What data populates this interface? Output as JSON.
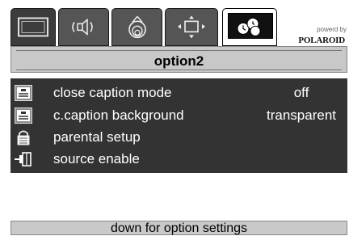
{
  "logo": {
    "powered_by": "powerd by",
    "brand": "POLAROID"
  },
  "header": {
    "title": "option2"
  },
  "menu": {
    "items": [
      {
        "label": "close caption mode",
        "value": "off",
        "icon": "closed-caption-icon"
      },
      {
        "label": "c.caption background",
        "value": "transparent",
        "icon": "closed-caption-icon"
      },
      {
        "label": "parental setup",
        "value": "",
        "icon": "lock-icon"
      },
      {
        "label": "source enable",
        "value": "",
        "icon": "input-source-icon"
      }
    ]
  },
  "footer": {
    "hint": "down for option settings"
  },
  "tabs": [
    {
      "icon": "picture-icon"
    },
    {
      "icon": "audio-icon"
    },
    {
      "icon": "color-adjust-icon"
    },
    {
      "icon": "screen-adjust-icon"
    },
    {
      "icon": "options-icon",
      "selected": true
    }
  ]
}
